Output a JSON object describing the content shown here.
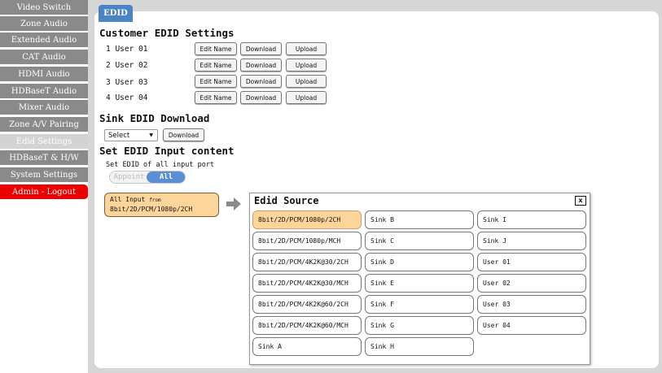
{
  "sidebar": {
    "items": [
      {
        "label": "Video Switch"
      },
      {
        "label": "Zone Audio"
      },
      {
        "label": "Extended Audio"
      },
      {
        "label": "CAT Audio"
      },
      {
        "label": "HDMI Audio"
      },
      {
        "label": "HDBaseT Audio"
      },
      {
        "label": "Mixer Audio"
      },
      {
        "label": "Zone A/V Pairing"
      },
      {
        "label": "Edid Settings"
      },
      {
        "label": "HDBaseT & H/W"
      },
      {
        "label": "System Settings"
      },
      {
        "label": "Admin - Logout"
      }
    ],
    "active_index": 8
  },
  "tab": {
    "label": "EDID"
  },
  "customer": {
    "title": "Customer EDID Settings",
    "users": [
      {
        "label": "1 User 01"
      },
      {
        "label": "2 User 02"
      },
      {
        "label": "3 User 03"
      },
      {
        "label": "4 User 04"
      }
    ],
    "edit_name_label": "Edit Name",
    "download_label": "Download",
    "upload_label": "Upload"
  },
  "sink": {
    "title": "Sink EDID Download",
    "select_value": "Select",
    "download_label": "Download"
  },
  "input_content": {
    "title": "Set EDID Input content",
    "subtitle": "Set EDID of all input port",
    "toggle_off": "Appoint",
    "toggle_on": "All",
    "all_input_prefix": "All Input",
    "all_input_from": "from",
    "all_input_value": "8bit/2D/PCM/1080p/2CH"
  },
  "edid_source": {
    "title": "Edid Source",
    "close_label": "x",
    "columns": [
      [
        "8bit/2D/PCM/1080p/2CH",
        "8bit/2D/PCM/1080p/MCH",
        "8bit/2D/PCM/4K2K@30/2CH",
        "8bit/2D/PCM/4K2K@30/MCH",
        "8bit/2D/PCM/4K2K@60/2CH",
        "8bit/2D/PCM/4K2K@60/MCH",
        "Sink A"
      ],
      [
        "Sink B",
        "Sink C",
        "Sink D",
        "Sink E",
        "Sink F",
        "Sink G",
        "Sink H"
      ],
      [
        "Sink I",
        "Sink J",
        "User 01",
        "User 02",
        "User 03",
        "User 04"
      ]
    ],
    "selected": "8bit/2D/PCM/1080p/2CH"
  },
  "colors": {
    "accent_blue": "#4a84c5",
    "selected_orange": "#fdd59a",
    "logout_red": "#ee0000",
    "sidebar_gray": "#8a8a8a"
  }
}
